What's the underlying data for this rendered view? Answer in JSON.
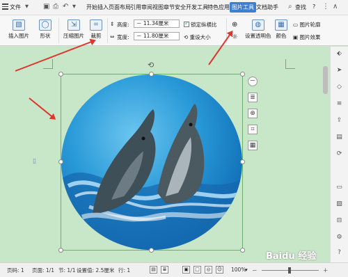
{
  "menubar": {
    "file_label": "文件",
    "tabs": [
      "开始",
      "插入",
      "页面布局",
      "引用",
      "审阅",
      "视图",
      "章节",
      "安全",
      "开发工具",
      "特色应用",
      "图片工具",
      "文档助手"
    ],
    "search_label": "查找",
    "help": "?"
  },
  "ribbon": {
    "insert_picture": "插入图片",
    "shape": "形状",
    "compress": "压缩图片",
    "crop": "裁剪",
    "height_label": "高度:",
    "height_value": "11.34厘米",
    "width_label": "宽度:",
    "width_value": "11.80厘米",
    "lock_ratio": "锁定纵横比",
    "reset_size": "重设大小",
    "set_transparent": "设置透明色",
    "color": "颜色",
    "picture_outline": "图片轮廓",
    "picture_effect": "图片效果"
  },
  "statusbar": {
    "page": "页码: 1",
    "pages": "页面: 1/1",
    "section": "节: 1/1",
    "position": "设置值: 2.5厘米",
    "row": "行: 1",
    "zoom": "100%"
  },
  "watermark": "Baidu 经验"
}
